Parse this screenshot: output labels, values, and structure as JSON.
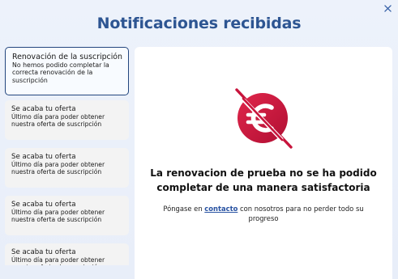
{
  "header": {
    "title": "Notificaciones recibidas",
    "close_icon": "close-icon"
  },
  "notifications": [
    {
      "title": "Renovación de la suscripción",
      "description": "No hemos podido completar la correcta renovación de la suscripción",
      "selected": true
    },
    {
      "title": "Se acaba tu oferta",
      "description": "Último día para poder obtener nuestra oferta de suscripción",
      "selected": false
    },
    {
      "title": "Se acaba tu oferta",
      "description": "Último día para poder obtener nuestra oferta de suscripción",
      "selected": false
    },
    {
      "title": "Se acaba tu oferta",
      "description": "Último día para poder obtener nuestra oferta de suscripción",
      "selected": false
    },
    {
      "title": "Se acaba tu oferta",
      "description": "Último día para poder obtener nuestra oferta de suscripción",
      "selected": false
    }
  ],
  "detail": {
    "icon": "euro-crossed-icon",
    "headline": "La renovacion de prueba no se ha podido completar de una manera satisfactoria",
    "text_before": "Póngase en ",
    "link_label": "contacto",
    "text_after": " con nosotros para no perder todo su progreso"
  },
  "colors": {
    "title": "#2d5592",
    "accent_red": "#c8143c",
    "selected_border": "#23467e",
    "link": "#2852a2"
  }
}
